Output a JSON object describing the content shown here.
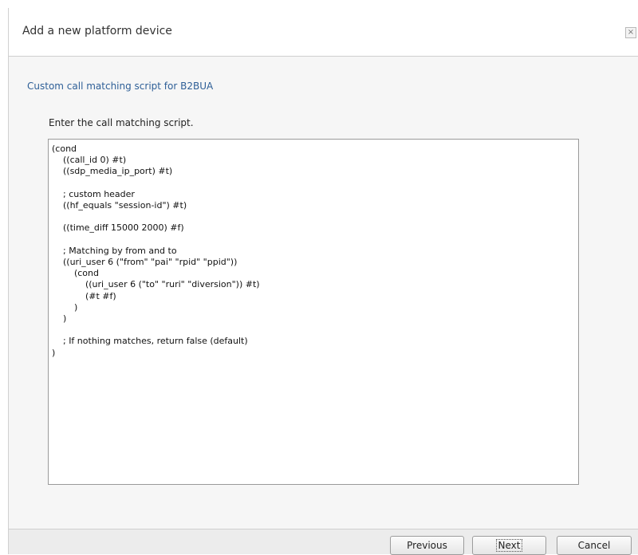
{
  "dialog": {
    "title": "Add a new platform device",
    "close_label": "×"
  },
  "content": {
    "section_label": "Custom call matching script for B2BUA",
    "instruction": "Enter the call matching script.",
    "script": "(cond\n    ((call_id 0) #t)\n    ((sdp_media_ip_port) #t)\n\n    ; custom header\n    ((hf_equals \"session-id\") #t)\n\n    ((time_diff 15000 2000) #f)\n\n    ; Matching by from and to\n    ((uri_user 6 (\"from\" \"pai\" \"rpid\" \"ppid\"))\n        (cond\n            ((uri_user 6 (\"to\" \"ruri\" \"diversion\")) #t)\n            (#t #f)\n        )\n    )\n\n    ; If nothing matches, return false (default)\n)"
  },
  "footer": {
    "previous_label": "Previous",
    "next_label": "Next",
    "cancel_label": "Cancel"
  }
}
